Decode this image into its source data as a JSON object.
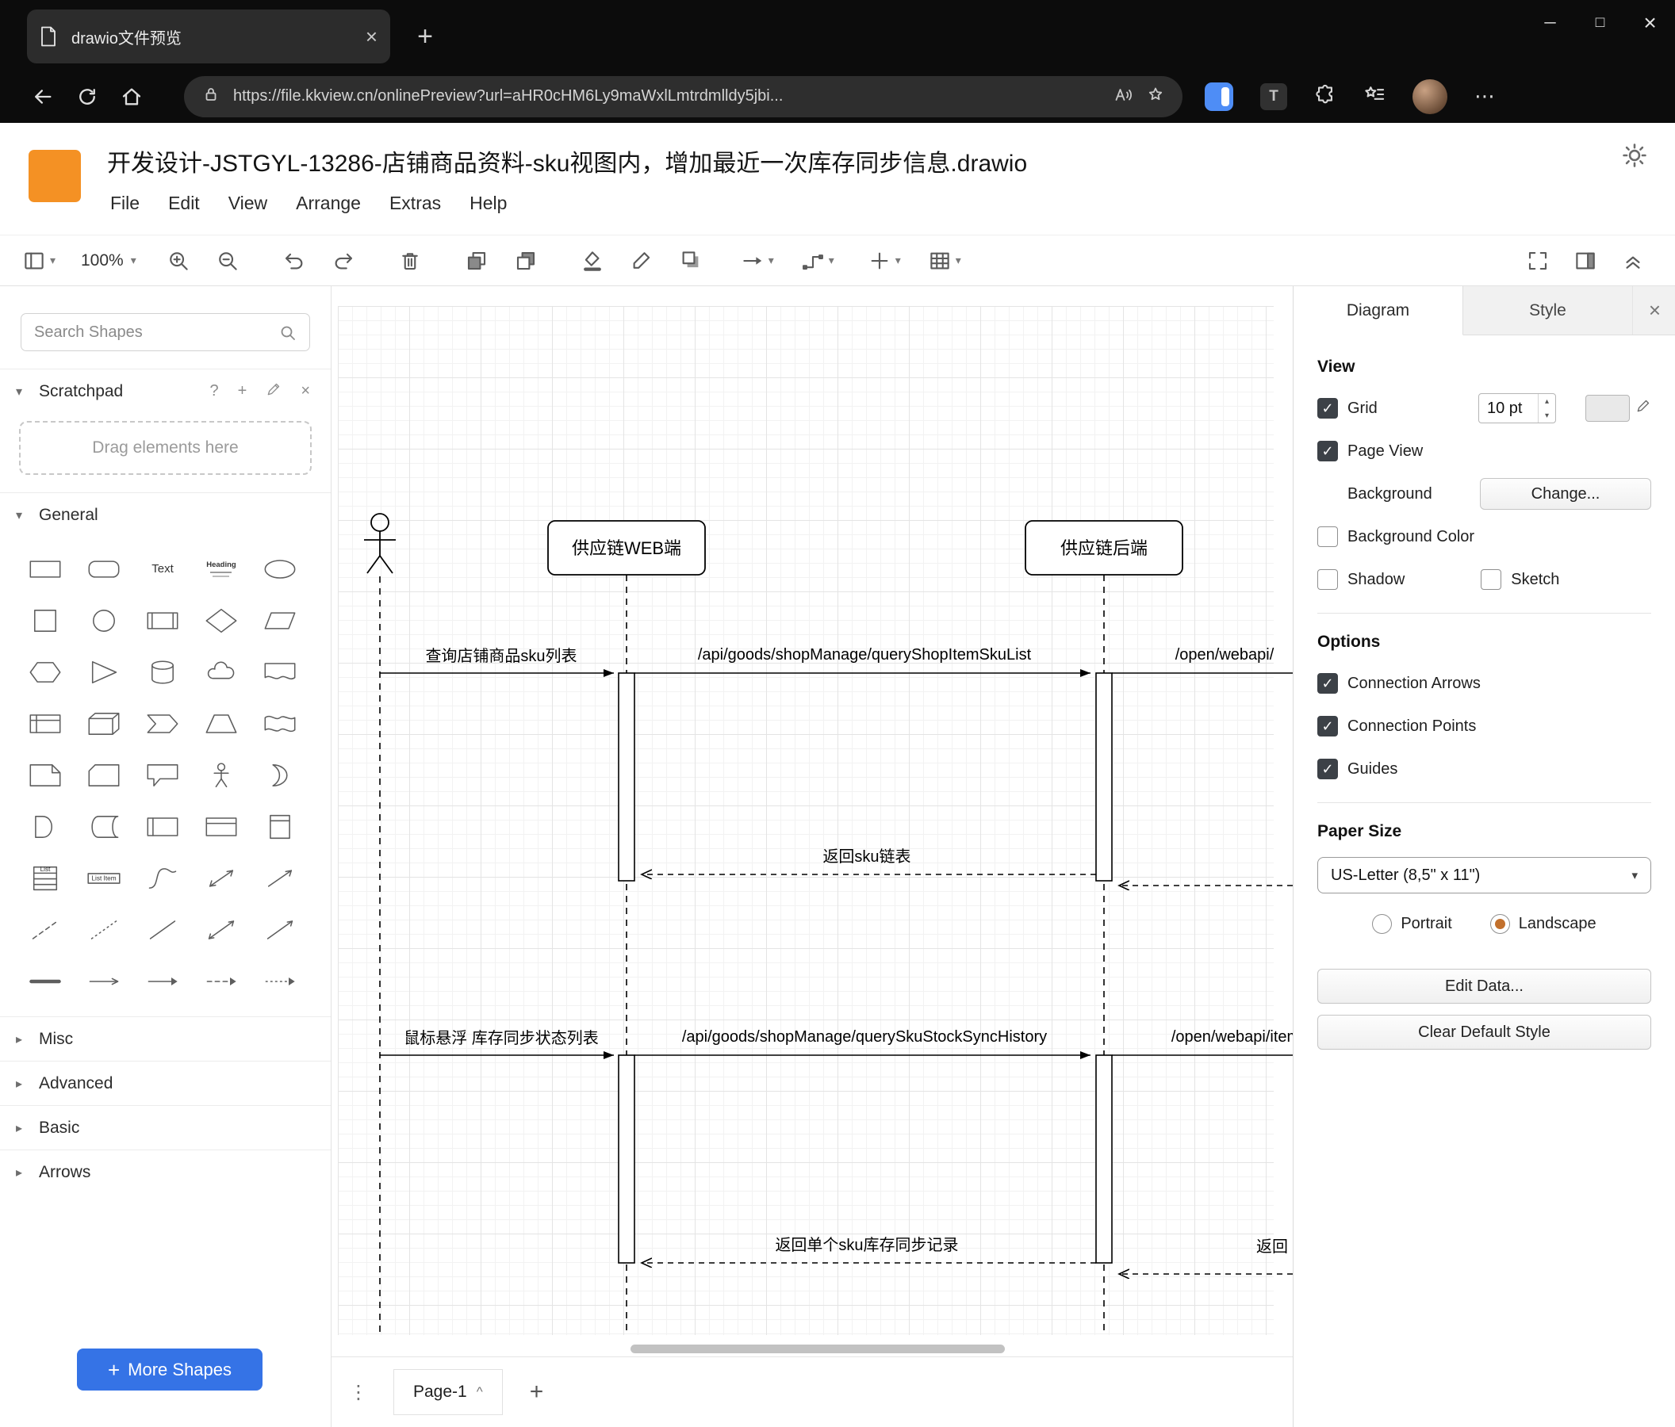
{
  "icons": {
    "close": "×",
    "plus": "+",
    "minimize": "─",
    "maximize": "□",
    "dots_v": "⋮",
    "dots_h": "⋯",
    "caret": "▾",
    "chevron_down": "▾",
    "chevron_right": "▸",
    "caret_up": "^",
    "spin_up": "▴",
    "spin_down": "▾",
    "help": "?"
  },
  "browser": {
    "tab_title": "drawio文件预览",
    "url": "https://file.kkview.cn/onlinePreview?url=aHR0cHM6Ly9maWxlLmtrdmlldy5jbi..."
  },
  "header": {
    "title": "开发设计-JSTGYL-13286-店铺商品资料-sku视图内，增加最近一次库存同步信息.drawio",
    "menus": {
      "file": "File",
      "edit": "Edit",
      "view": "View",
      "arrange": "Arrange",
      "extras": "Extras",
      "help": "Help"
    }
  },
  "toolbar": {
    "zoom_level": "100%"
  },
  "sidebar": {
    "search_placeholder": "Search Shapes",
    "scratchpad_title": "Scratchpad",
    "scratchpad_hint": "Drag elements here",
    "sections": {
      "general": "General",
      "misc": "Misc",
      "advanced": "Advanced",
      "basic": "Basic",
      "arrows": "Arrows"
    },
    "shape_labels": {
      "text": "Text",
      "heading": "Heading",
      "list": "List",
      "list_item": "List Item"
    },
    "more_shapes_label": "More Shapes"
  },
  "diagram": {
    "lifeline_web": "供应链WEB端",
    "lifeline_backend": "供应链后端",
    "msg_query_sku_list": "查询店铺商品sku列表",
    "msg_api_query_shop_item_sku_list": "/api/goods/shopManage/queryShopItemSkuList",
    "msg_open_webapi": "/open/webapi/",
    "msg_return_sku_list": "返回sku链表",
    "msg_hover_stock_sync": "鼠标悬浮 库存同步状态列表",
    "msg_api_query_sku_stock_sync_history": "/api/goods/shopManage/querySkuStockSyncHistory",
    "msg_open_webapi_item": "/open/webapi/item",
    "msg_return_single_sku": "返回单个sku库存同步记录",
    "msg_return_partial": "返回"
  },
  "footer": {
    "page_tab": "Page-1"
  },
  "format": {
    "tab_diagram": "Diagram",
    "tab_style": "Style",
    "view_heading": "View",
    "grid_label": "Grid",
    "grid_size": "10 pt",
    "page_view_label": "Page View",
    "background_label": "Background",
    "change_button": "Change...",
    "background_color_label": "Background Color",
    "shadow_label": "Shadow",
    "sketch_label": "Sketch",
    "options_heading": "Options",
    "connection_arrows_label": "Connection Arrows",
    "connection_points_label": "Connection Points",
    "guides_label": "Guides",
    "paper_heading": "Paper Size",
    "paper_size_value": "US-Letter (8,5\" x 11\")",
    "portrait_label": "Portrait",
    "landscape_label": "Landscape",
    "edit_data_button": "Edit Data...",
    "clear_default_style_button": "Clear Default Style"
  }
}
